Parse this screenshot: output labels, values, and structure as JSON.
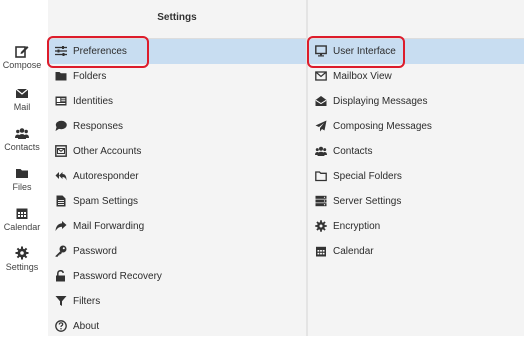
{
  "nav": {
    "compose": "Compose",
    "mail": "Mail",
    "contacts": "Contacts",
    "files": "Files",
    "calendar": "Calendar",
    "settings": "Settings"
  },
  "settings_panel": {
    "title": "Settings",
    "items": [
      {
        "label": "Preferences",
        "icon": "sliders-icon",
        "selected": true
      },
      {
        "label": "Folders",
        "icon": "folder-icon"
      },
      {
        "label": "Identities",
        "icon": "id-card-icon"
      },
      {
        "label": "Responses",
        "icon": "comment-icon"
      },
      {
        "label": "Other Accounts",
        "icon": "envelope-square-icon"
      },
      {
        "label": "Autoresponder",
        "icon": "reply-all-icon"
      },
      {
        "label": "Spam Settings",
        "icon": "document-icon"
      },
      {
        "label": "Mail Forwarding",
        "icon": "share-arrow-icon"
      },
      {
        "label": "Password",
        "icon": "key-icon"
      },
      {
        "label": "Password Recovery",
        "icon": "unlock-icon"
      },
      {
        "label": "Filters",
        "icon": "filter-icon"
      },
      {
        "label": "About",
        "icon": "question-circle-icon"
      }
    ]
  },
  "preferences_panel": {
    "items": [
      {
        "label": "User Interface",
        "icon": "monitor-icon",
        "selected": true
      },
      {
        "label": "Mailbox View",
        "icon": "envelope-outline-icon"
      },
      {
        "label": "Displaying Messages",
        "icon": "envelope-open-icon"
      },
      {
        "label": "Composing Messages",
        "icon": "paper-plane-icon"
      },
      {
        "label": "Contacts",
        "icon": "users-icon"
      },
      {
        "label": "Special Folders",
        "icon": "folder-outline-icon"
      },
      {
        "label": "Server Settings",
        "icon": "server-icon"
      },
      {
        "label": "Encryption",
        "icon": "cog-icon"
      },
      {
        "label": "Calendar",
        "icon": "calendar-icon"
      }
    ]
  },
  "colors": {
    "selected_row": "#c8ddf1",
    "highlight_outline": "#dd1c2b",
    "panel_bg": "#f4f4f4"
  }
}
